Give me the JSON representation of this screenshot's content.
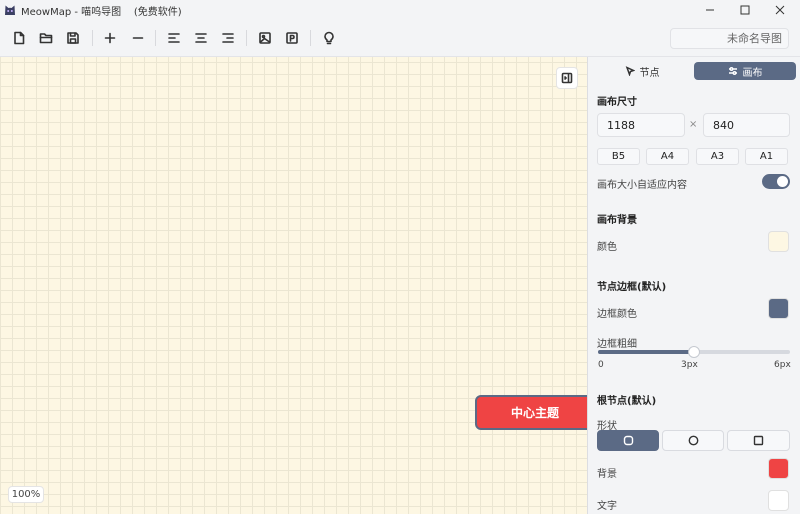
{
  "window": {
    "title": "MeowMap - 喵呜导图    (免费软件)",
    "minimize_icon": "minimize-icon",
    "maximize_icon": "maximize-icon",
    "close_icon": "close-icon"
  },
  "toolbar": {
    "buttons": [
      "new-file-icon",
      "open-folder-icon",
      "save-icon",
      "add-node-icon",
      "remove-node-icon",
      "align-left-icon",
      "align-center-icon",
      "align-right-icon",
      "insert-image-icon",
      "insert-note-icon",
      "idea-bulb-icon"
    ],
    "name_placeholder": "未命名导图"
  },
  "canvas": {
    "background_color": "#fdf7e3",
    "zoom": "100%",
    "root_node": {
      "text": "中心主题",
      "fill": "#ef4444",
      "border": "#5b6a85"
    }
  },
  "sidebar": {
    "tabs": [
      {
        "label": "节点",
        "icon": "cursor-icon",
        "active": false
      },
      {
        "label": "画布",
        "icon": "sliders-icon",
        "active": true
      }
    ],
    "canvas_size": {
      "title": "画布尺寸",
      "width": "1188",
      "times": "×",
      "height": "840",
      "presets": [
        "B5",
        "A4",
        "A3",
        "A1"
      ],
      "auto_fit_label": "画布大小自适应内容",
      "auto_fit_on": true
    },
    "canvas_bg": {
      "title": "画布背景",
      "color_label": "颜色",
      "color": "#fdf7e3"
    },
    "node_border": {
      "title": "节点边框(默认)",
      "color_label": "边框颜色",
      "color": "#5b6a85",
      "width_label": "边框粗细",
      "width_min": "0",
      "width_value": "3px",
      "width_max": "6px",
      "width_fraction": 0.5
    },
    "root_node": {
      "title": "根节点(默认)",
      "shape_label": "形状",
      "shapes": [
        "rounded-rect-icon",
        "circle-icon",
        "square-icon"
      ],
      "active_shape": 0,
      "bg_label": "背景",
      "bg_color": "#ef4444",
      "text_label": "文字",
      "text_color": "#ffffff"
    }
  }
}
